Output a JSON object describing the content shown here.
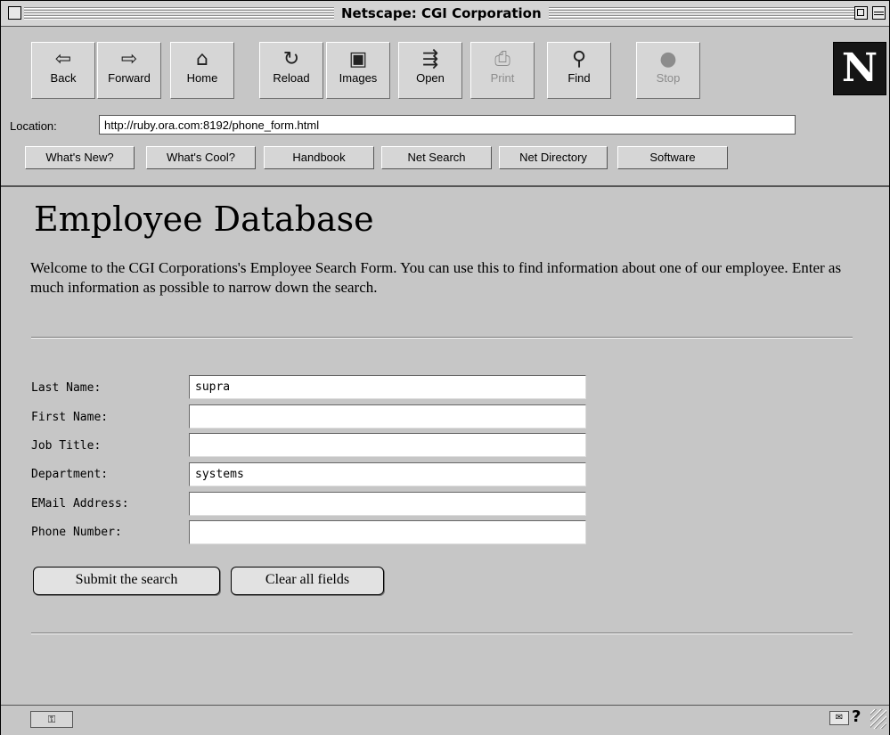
{
  "window": {
    "title": "Netscape: CGI Corporation"
  },
  "toolbar": {
    "buttons": [
      {
        "label": "Back",
        "icon": "back-arrow-icon"
      },
      {
        "label": "Forward",
        "icon": "forward-arrow-icon"
      },
      {
        "label": "Home",
        "icon": "home-icon"
      },
      {
        "label": "Reload",
        "icon": "reload-icon"
      },
      {
        "label": "Images",
        "icon": "images-icon"
      },
      {
        "label": "Open",
        "icon": "open-icon"
      },
      {
        "label": "Print",
        "icon": "print-icon"
      },
      {
        "label": "Find",
        "icon": "find-binoculars-icon"
      },
      {
        "label": "Stop",
        "icon": "stop-icon"
      }
    ],
    "logo": "N"
  },
  "location": {
    "label": "Location:",
    "url": "http://ruby.ora.com:8192/phone_form.html"
  },
  "directory_buttons": [
    "What's New?",
    "What's Cool?",
    "Handbook",
    "Net Search",
    "Net Directory",
    "Software"
  ],
  "page": {
    "title": "Employee Database",
    "intro": "Welcome to the CGI Corporations's Employee Search Form. You can use this to find information about one of our employee. Enter as much information as possible to narrow down the search.",
    "fields": [
      {
        "label": "Last Name:",
        "value": "supra"
      },
      {
        "label": "First Name:",
        "value": ""
      },
      {
        "label": "Job Title:",
        "value": ""
      },
      {
        "label": "Department:",
        "value": "systems"
      },
      {
        "label": "EMail Address:",
        "value": ""
      },
      {
        "label": "Phone Number:",
        "value": ""
      }
    ],
    "submit_label": "Submit the search",
    "clear_label": "Clear all fields"
  },
  "statusbar": {
    "security_icon": "broken-key-icon",
    "mail_icon": "mail-icon",
    "help_icon": "question-icon",
    "help_text": "?"
  },
  "colors": {
    "chrome": "#c6c6c6",
    "logo_bg": "#151515"
  }
}
